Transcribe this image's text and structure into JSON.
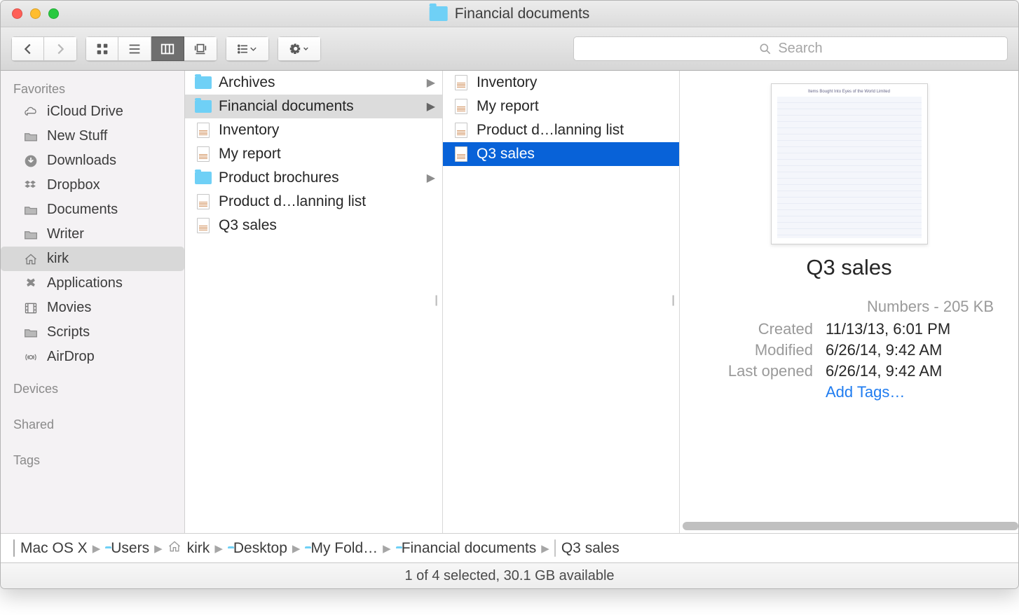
{
  "window": {
    "title": "Financial documents"
  },
  "toolbar": {
    "search_placeholder": "Search"
  },
  "sidebar": {
    "sections": [
      {
        "header": "Favorites",
        "items": [
          {
            "icon": "cloud",
            "label": "iCloud Drive"
          },
          {
            "icon": "folder-gray",
            "label": "New Stuff"
          },
          {
            "icon": "download",
            "label": "Downloads"
          },
          {
            "icon": "dropbox",
            "label": "Dropbox"
          },
          {
            "icon": "folder-gray",
            "label": "Documents"
          },
          {
            "icon": "folder-gray",
            "label": "Writer"
          },
          {
            "icon": "home",
            "label": "kirk",
            "selected": true
          },
          {
            "icon": "apps",
            "label": "Applications"
          },
          {
            "icon": "film",
            "label": "Movies"
          },
          {
            "icon": "folder-gray",
            "label": "Scripts"
          },
          {
            "icon": "airdrop",
            "label": "AirDrop"
          }
        ]
      },
      {
        "header": "Devices",
        "items": []
      },
      {
        "header": "Shared",
        "items": []
      },
      {
        "header": "Tags",
        "items": []
      }
    ]
  },
  "columns": [
    {
      "items": [
        {
          "type": "folder",
          "label": "Archives",
          "arrow": true
        },
        {
          "type": "folder",
          "label": "Financial documents",
          "arrow": true,
          "highlight": true
        },
        {
          "type": "doc",
          "label": "Inventory"
        },
        {
          "type": "doc",
          "label": "My report"
        },
        {
          "type": "folder",
          "label": "Product brochures",
          "arrow": true
        },
        {
          "type": "doc",
          "label": "Product d…lanning list"
        },
        {
          "type": "doc-blank",
          "label": "Q3 sales"
        }
      ]
    },
    {
      "items": [
        {
          "type": "doc",
          "label": "Inventory"
        },
        {
          "type": "doc",
          "label": "My report"
        },
        {
          "type": "doc",
          "label": "Product d…lanning list"
        },
        {
          "type": "doc-blank",
          "label": "Q3 sales",
          "selected": true
        }
      ]
    }
  ],
  "preview": {
    "title": "Q3 sales",
    "kind_size": "Numbers - 205 KB",
    "rows": [
      {
        "label": "Created",
        "value": "11/13/13, 6:01 PM"
      },
      {
        "label": "Modified",
        "value": "6/26/14, 9:42 AM"
      },
      {
        "label": "Last opened",
        "value": "6/26/14, 9:42 AM"
      }
    ],
    "add_tags": "Add Tags…",
    "thumb_caption": "Items Bought Into Eyes of the World Limited"
  },
  "pathbar": [
    {
      "icon": "hd",
      "label": "Mac OS X"
    },
    {
      "icon": "folder",
      "label": "Users"
    },
    {
      "icon": "home",
      "label": "kirk"
    },
    {
      "icon": "folder",
      "label": "Desktop"
    },
    {
      "icon": "folder",
      "label": "My Fold…"
    },
    {
      "icon": "folder",
      "label": "Financial documents"
    },
    {
      "icon": "doc",
      "label": "Q3 sales"
    }
  ],
  "statusbar": "1 of 4 selected, 30.1 GB available"
}
